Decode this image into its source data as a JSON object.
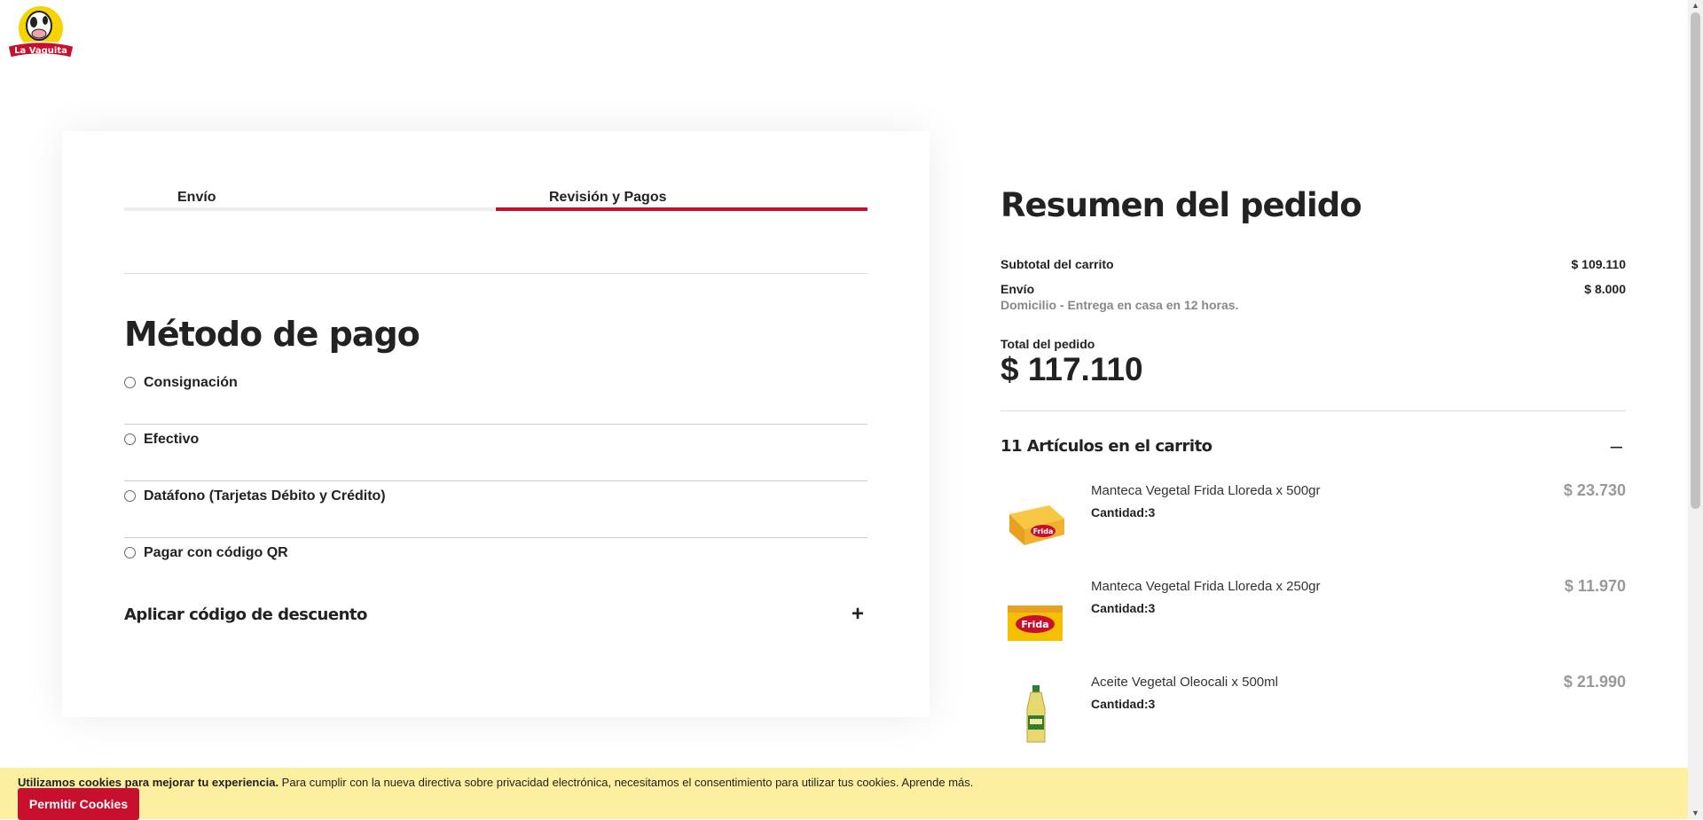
{
  "brand": {
    "logo_text": "La Vaquita",
    "accent": "#c8102e"
  },
  "tabs": [
    {
      "label": "Envío",
      "active": false
    },
    {
      "label": "Revisión y Pagos",
      "active": true
    }
  ],
  "payment": {
    "title": "Método de pago",
    "options": [
      {
        "label": "Consignación"
      },
      {
        "label": "Efectivo"
      },
      {
        "label": "Datáfono (Tarjetas Débito y Crédito)"
      },
      {
        "label": "Pagar con código QR"
      }
    ],
    "discount_label": "Aplicar código de descuento",
    "discount_toggle": "+"
  },
  "summary": {
    "title": "Resumen del pedido",
    "subtotal_label": "Subtotal del carrito",
    "subtotal_value": "$ 109.110",
    "shipping_label": "Envío",
    "shipping_value": "$ 8.000",
    "shipping_desc": "Domicilio - Entrega en casa en 12 horas.",
    "total_label": "Total del pedido",
    "total_value": "$ 117.110",
    "items_header": "11 Artículos en el carrito",
    "items_toggle": "–",
    "items": [
      {
        "name": "Manteca Vegetal Frida Lloreda x 500gr",
        "qty": "Cantidad:3",
        "price": "$ 23.730",
        "icon": "butter-box-icon"
      },
      {
        "name": "Manteca Vegetal Frida Lloreda x 250gr",
        "qty": "Cantidad:3",
        "price": "$ 11.970",
        "icon": "butter-box-icon"
      },
      {
        "name": "Aceite Vegetal Oleocali x 500ml",
        "qty": "Cantidad:3",
        "price": "$ 21.990",
        "icon": "oil-bottle-icon"
      }
    ]
  },
  "cookies": {
    "bold_text": "Utilizamos cookies para mejorar tu experiencia.",
    "text": " Para cumplir con la nueva directiva sobre privacidad electrónica, necesitamos el consentimiento para utilizar tus cookies.",
    "link": " Aprende más.",
    "button": "Permitir Cookies"
  }
}
